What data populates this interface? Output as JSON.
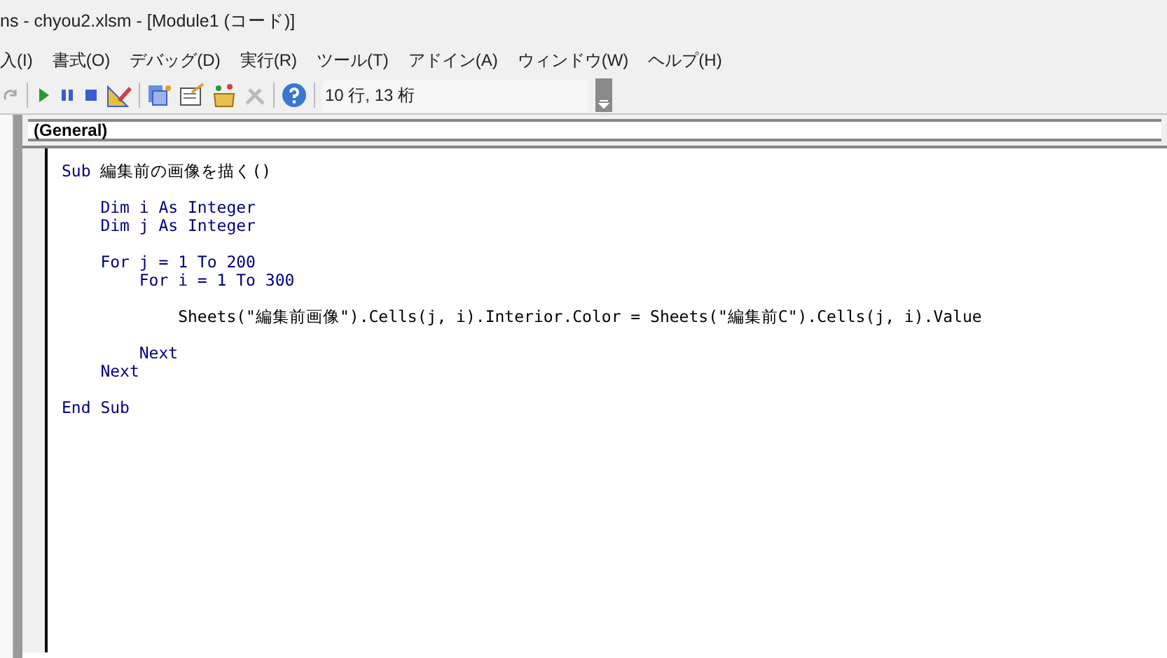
{
  "window": {
    "title": "ns - chyou2.xlsm - [Module1 (コード)]"
  },
  "menu": [
    "入(I)",
    "書式(O)",
    "デバッグ(D)",
    "実行(R)",
    "ツール(T)",
    "アドイン(A)",
    "ウィンドウ(W)",
    "ヘルプ(H)"
  ],
  "toolbar": {
    "position": "10 行, 13 桁"
  },
  "object_combo": {
    "value": "(General)"
  },
  "code": [
    {
      "blank_before": false,
      "tokens": [
        {
          "kind": "keyword",
          "text": "Sub"
        },
        {
          "kind": "plain",
          "text": " 編集前の画像を描く()"
        }
      ]
    },
    {
      "blank_before": true,
      "tokens": [
        {
          "kind": "keyword",
          "text": "    Dim i As Integer"
        }
      ]
    },
    {
      "blank_before": false,
      "tokens": [
        {
          "kind": "keyword",
          "text": "    Dim j As Integer"
        }
      ]
    },
    {
      "blank_before": true,
      "tokens": [
        {
          "kind": "keyword",
          "text": "    For j = 1 To 200"
        }
      ]
    },
    {
      "blank_before": false,
      "tokens": [
        {
          "kind": "keyword",
          "text": "        For i = 1 To 300"
        }
      ]
    },
    {
      "blank_before": true,
      "tokens": [
        {
          "kind": "plain",
          "text": "            Sheets(\"編集前画像\").Cells(j, i).Interior.Color = Sheets(\"編集前C\").Cells(j, i).Value"
        }
      ]
    },
    {
      "blank_before": true,
      "tokens": [
        {
          "kind": "keyword",
          "text": "        Next"
        }
      ]
    },
    {
      "blank_before": false,
      "tokens": [
        {
          "kind": "keyword",
          "text": "    Next"
        }
      ]
    },
    {
      "blank_before": true,
      "tokens": [
        {
          "kind": "keyword",
          "text": "End Sub"
        }
      ]
    }
  ]
}
